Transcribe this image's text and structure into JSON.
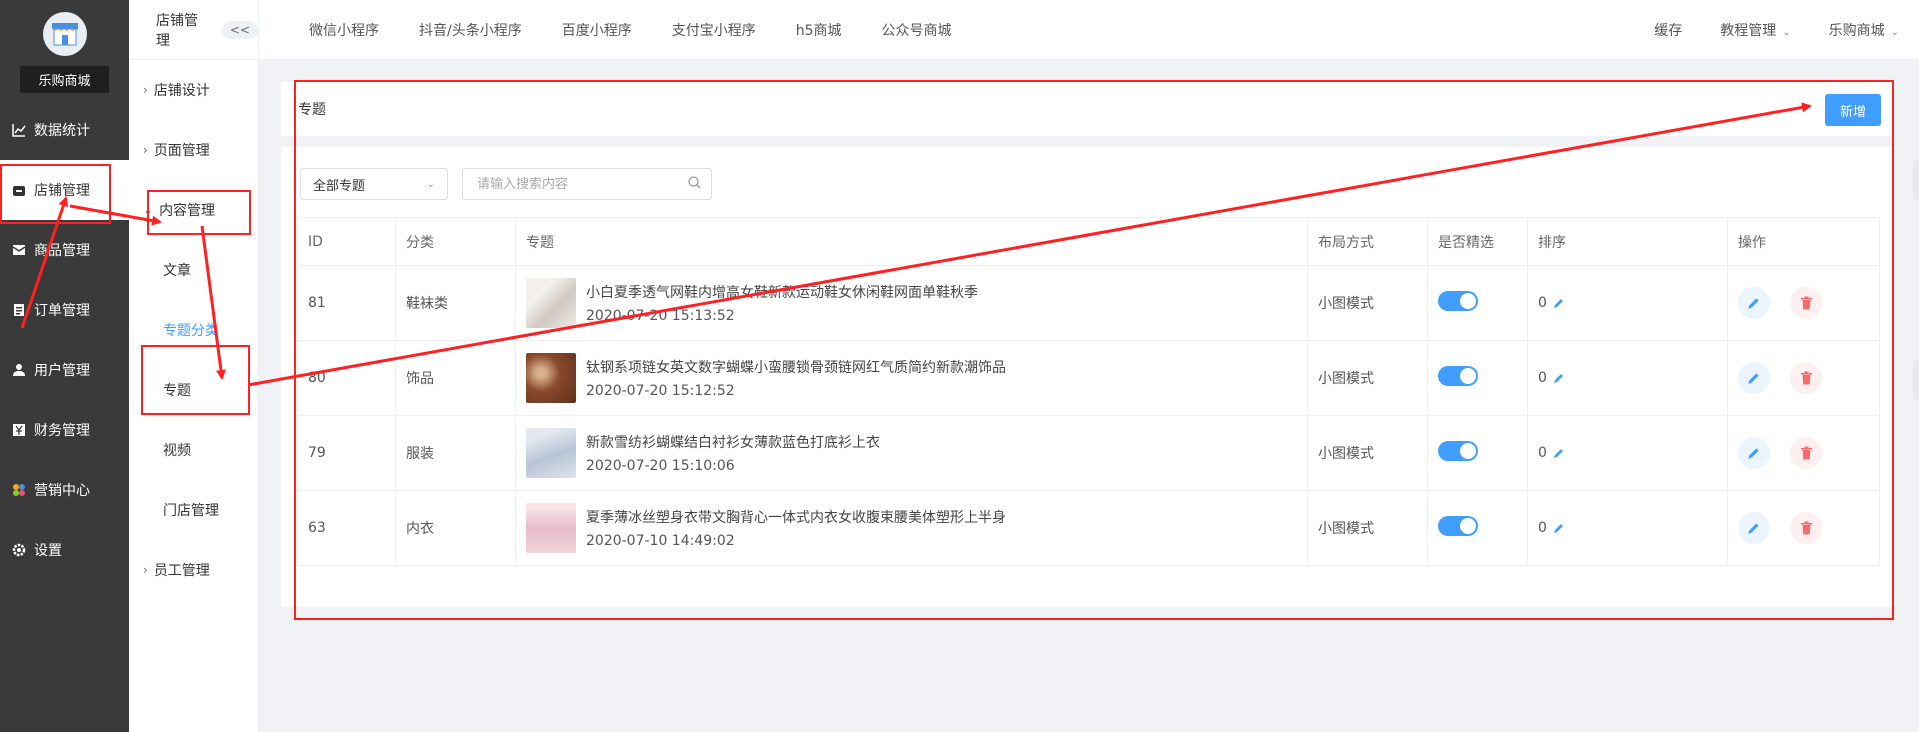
{
  "sidebar": {
    "shop_name": "乐购商城",
    "items": [
      {
        "label": "数据统计",
        "icon": "chart-line-icon"
      },
      {
        "label": "店铺管理",
        "icon": "store-icon"
      },
      {
        "label": "商品管理",
        "icon": "product-icon"
      },
      {
        "label": "订单管理",
        "icon": "order-icon"
      },
      {
        "label": "用户管理",
        "icon": "user-icon"
      },
      {
        "label": "财务管理",
        "icon": "finance-icon"
      },
      {
        "label": "营销中心",
        "icon": "marketing-icon"
      },
      {
        "label": "设置",
        "icon": "gear-icon"
      }
    ]
  },
  "subbar": {
    "title": "店铺管理",
    "collapse_label": "<<",
    "items": [
      {
        "label": "店铺设计"
      },
      {
        "label": "页面管理"
      },
      {
        "label": "内容管理"
      },
      {
        "label": "文章"
      },
      {
        "label": "专题分类"
      },
      {
        "label": "专题"
      },
      {
        "label": "视频"
      },
      {
        "label": "门店管理"
      },
      {
        "label": "员工管理"
      }
    ]
  },
  "topbar": {
    "tabs": [
      "微信小程序",
      "抖音/头条小程序",
      "百度小程序",
      "支付宝小程序",
      "h5商城",
      "公众号商城"
    ],
    "right": {
      "cache": "缓存",
      "tutorial": "教程管理",
      "shop": "乐购商城"
    }
  },
  "page": {
    "title": "专题",
    "add_label": "新增",
    "filter_select": "全部专题",
    "search_placeholder": "请输入搜索内容"
  },
  "table": {
    "headers": [
      "ID",
      "分类",
      "专题",
      "布局方式",
      "是否精选",
      "排序",
      "操作"
    ],
    "rows": [
      {
        "id": "81",
        "category": "鞋袜类",
        "title": "小白夏季透气网鞋内增高女鞋新款运动鞋女休闲鞋网面单鞋秋季",
        "date": "2020-07-20 15:13:52",
        "layout": "小图模式",
        "sort": "0",
        "thumb_color": "#d9d4cf"
      },
      {
        "id": "80",
        "category": "饰品",
        "title": "钛钢系项链女英文数字蝴蝶小蛮腰锁骨颈链网红气质简约新款潮饰品",
        "date": "2020-07-20 15:12:52",
        "layout": "小图模式",
        "sort": "0",
        "thumb_color": "#8a4a2e"
      },
      {
        "id": "79",
        "category": "服装",
        "title": "新款雪纺衫蝴蝶结白衬衫女薄款蓝色打底衫上衣",
        "date": "2020-07-20 15:10:06",
        "layout": "小图模式",
        "sort": "0",
        "thumb_color": "#b8c4d6"
      },
      {
        "id": "63",
        "category": "内衣",
        "title": "夏季薄冰丝塑身衣带文胸背心一体式内衣女收腹束腰美体塑形上半身",
        "date": "2020-07-10 14:49:02",
        "layout": "小图模式",
        "sort": "0",
        "thumb_color": "#e8bcc8"
      }
    ]
  },
  "colors": {
    "accent": "#409eff",
    "danger": "#f56c6c",
    "annotation": "#ff2020",
    "sidebar_bg": "#3a3a3a"
  }
}
